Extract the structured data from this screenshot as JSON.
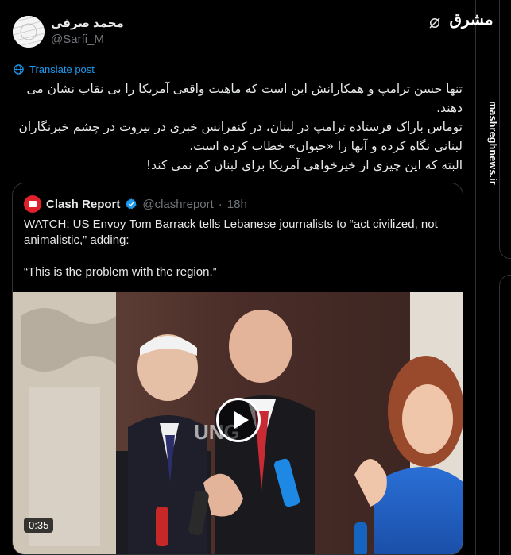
{
  "author": {
    "display_name": "محمد صرفی",
    "handle": "@Sarfi_M"
  },
  "watermark": {
    "logo_text": "مشرق",
    "site": "mashreghnews.ir"
  },
  "translate_label": "Translate post",
  "post_lines": [
    "تنها حسن ترامپ و همکارانش این است که ماهیت واقعی آمریکا را بی نقاب نشان می دهند.",
    "توماس باراک فرستاده ترامپ در لبنان، در کنفرانس خبری در بیروت در چشم خبرنگاران لبنانی نگاه کرده و آنها را «حیوان» خطاب کرده است.",
    "البته که این چیزی از خیرخواهی آمریکا برای لبنان کم نمی کند!"
  ],
  "quote": {
    "name": "Clash Report",
    "handle": "@clashreport",
    "separator": "·",
    "time": "18h",
    "text_1": "WATCH: US Envoy Tom Barrack tells Lebanese journalists to “act civilized, not animalistic,” adding:",
    "text_2": "“This is the problem with the region.”",
    "video": {
      "duration": "0:35",
      "logo": "UNG"
    }
  },
  "colors": {
    "link": "#1d9bf0",
    "muted": "#71767b",
    "text": "#e7e9ea",
    "brand": "#e0202b"
  }
}
